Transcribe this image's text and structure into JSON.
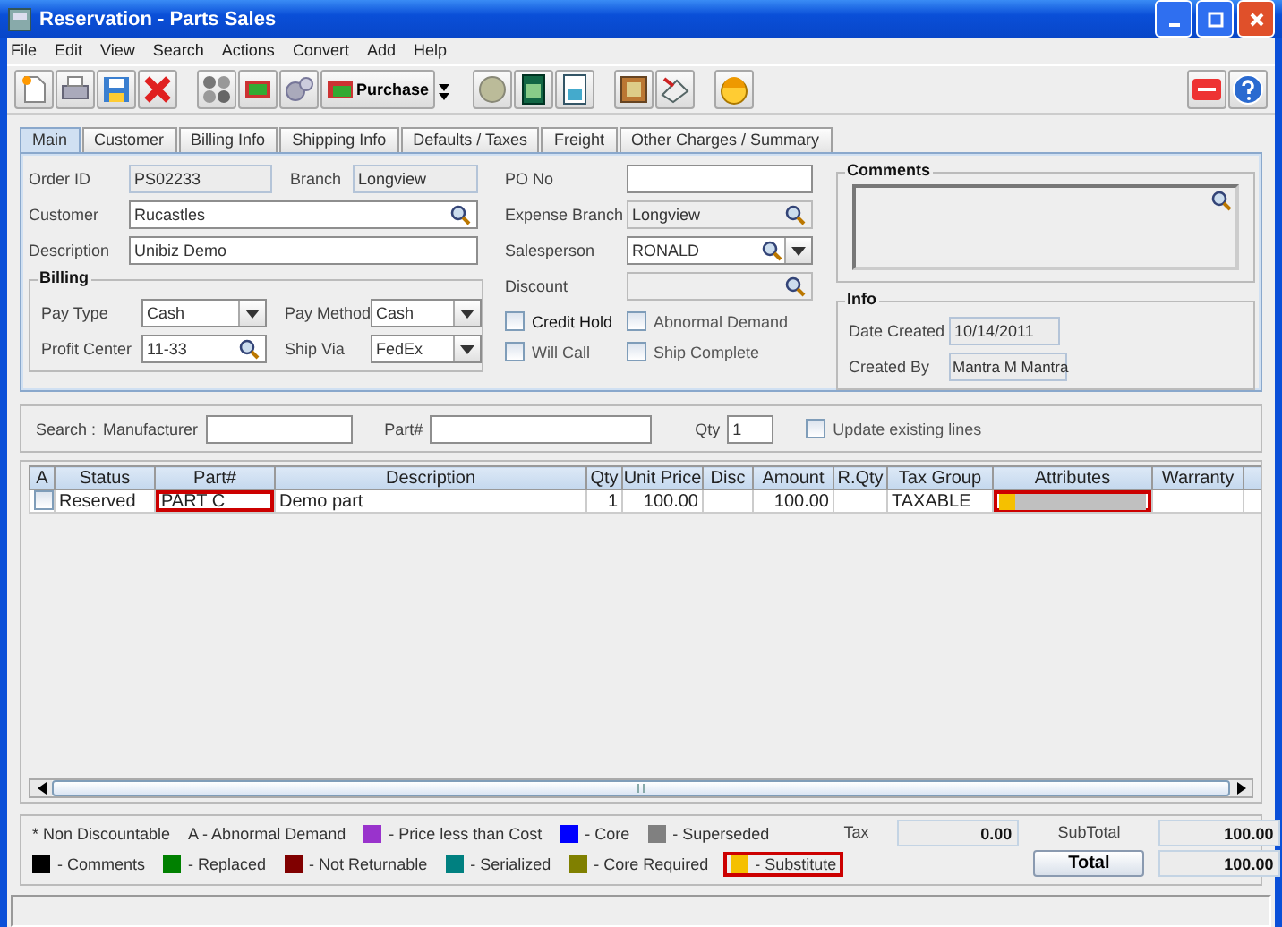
{
  "window": {
    "title": "Reservation - Parts Sales"
  },
  "menu": [
    {
      "label": "File"
    },
    {
      "label": "Edit"
    },
    {
      "label": "View"
    },
    {
      "label": "Search"
    },
    {
      "label": "Actions"
    },
    {
      "label": "Convert"
    },
    {
      "label": "Add"
    },
    {
      "label": "Help"
    }
  ],
  "toolbar": {
    "purchase_label": "Purchase"
  },
  "tabs": [
    {
      "label": "Main",
      "selected": true
    },
    {
      "label": "Customer",
      "selected": false
    },
    {
      "label": "Billing Info",
      "selected": false
    },
    {
      "label": "Shipping Info",
      "selected": false
    },
    {
      "label": "Defaults / Taxes",
      "selected": false
    },
    {
      "label": "Freight",
      "selected": false
    },
    {
      "label": "Other Charges / Summary",
      "selected": false
    }
  ],
  "form": {
    "order_id": {
      "label": "Order ID",
      "value": "PS02233"
    },
    "branch": {
      "label": "Branch",
      "value": "Longview"
    },
    "customer": {
      "label": "Customer",
      "value": "Rucastles"
    },
    "description": {
      "label": "Description",
      "value": "Unibiz Demo"
    },
    "billing": {
      "title": "Billing",
      "pay_type": {
        "label": "Pay Type",
        "value": "Cash"
      },
      "pay_method": {
        "label": "Pay Method",
        "value": "Cash"
      },
      "profit_center": {
        "label": "Profit Center",
        "value": "11-33"
      },
      "ship_via": {
        "label": "Ship Via",
        "value": "FedEx"
      }
    },
    "po_no": {
      "label": "PO No"
    },
    "expense_branch": {
      "label": "Expense Branch",
      "value": "Longview"
    },
    "salesperson": {
      "label": "Salesperson",
      "value": "RONALD"
    },
    "discount": {
      "label": "Discount"
    },
    "checkboxes": [
      {
        "label": "Credit Hold",
        "checked": false
      },
      {
        "label": "Abnormal Demand",
        "checked": false
      },
      {
        "label": "Will Call",
        "checked": false
      },
      {
        "label": "Ship Complete",
        "checked": false
      }
    ],
    "comments": {
      "title": "Comments"
    },
    "info": {
      "title": "Info",
      "date_created": {
        "label": "Date Created",
        "value": "10/14/2011"
      },
      "created_by": {
        "label": "Created By",
        "value": "Mantra M Mantra"
      }
    }
  },
  "search": {
    "label": "Search :",
    "manufacturer_label": "Manufacturer",
    "part_label": "Part#",
    "qty_label": "Qty",
    "qty_value": "1",
    "update_label": "Update existing lines",
    "update_checked": false
  },
  "table": {
    "columns": [
      {
        "label": "A",
        "kind": "text"
      },
      {
        "label": "Status",
        "kind": "text"
      },
      {
        "label": "Part#",
        "kind": "text"
      },
      {
        "label": "Description",
        "kind": "text"
      },
      {
        "label": "Qty",
        "kind": "number"
      },
      {
        "label": "Unit Price",
        "kind": "number"
      },
      {
        "label": "Disc",
        "kind": "number"
      },
      {
        "label": "Amount",
        "kind": "number"
      },
      {
        "label": "R.Qty",
        "kind": "number"
      },
      {
        "label": "Tax Group",
        "kind": "text"
      },
      {
        "label": "Attributes",
        "kind": "text"
      },
      {
        "label": "Warranty",
        "kind": "text"
      }
    ],
    "rows": [
      {
        "cells": [
          {
            "kind": "checkbox",
            "checked": false
          },
          {
            "kind": "text",
            "text": "Reserved",
            "highlighted": false
          },
          {
            "kind": "text",
            "text": "PART C",
            "highlighted": true
          },
          {
            "kind": "text",
            "text": "Demo part",
            "highlighted": false
          },
          {
            "kind": "text",
            "text": "1",
            "highlighted": false
          },
          {
            "kind": "text",
            "text": "100.00",
            "highlighted": false
          },
          {
            "kind": "empty"
          },
          {
            "kind": "text",
            "text": "100.00",
            "highlighted": false
          },
          {
            "kind": "empty"
          },
          {
            "kind": "text",
            "text": "TAXABLE",
            "highlighted": false
          },
          {
            "kind": "attributes",
            "color": "#f5c000",
            "highlighted": true
          },
          {
            "kind": "empty"
          }
        ]
      }
    ]
  },
  "legend": [
    {
      "kind": "text",
      "text": "* Non Discountable"
    },
    {
      "kind": "text",
      "text": "A - Abnormal Demand"
    },
    {
      "kind": "swatch",
      "color": "#9933cc",
      "text": "- Price less than Cost",
      "highlighted": false
    },
    {
      "kind": "swatch",
      "color": "#0000ff",
      "text": "- Core",
      "highlighted": false
    },
    {
      "kind": "swatch",
      "color": "#808080",
      "text": "- Superseded",
      "highlighted": false
    },
    {
      "kind": "break"
    },
    {
      "kind": "swatch",
      "color": "#000000",
      "text": "- Comments",
      "highlighted": false
    },
    {
      "kind": "swatch",
      "color": "#008000",
      "text": "- Replaced",
      "highlighted": false
    },
    {
      "kind": "swatch",
      "color": "#800000",
      "text": "- Not Returnable",
      "highlighted": false
    },
    {
      "kind": "swatch",
      "color": "#008080",
      "text": "- Serialized",
      "highlighted": false
    },
    {
      "kind": "swatch",
      "color": "#808000",
      "text": "- Core Required",
      "highlighted": false
    },
    {
      "kind": "swatch",
      "color": "#f5c000",
      "text": "- Substitute",
      "highlighted": true
    }
  ],
  "totals": {
    "tax_label": "Tax",
    "tax": "0.00",
    "subtotal_label": "SubTotal",
    "subtotal": "100.00",
    "total_button": "Total",
    "total": "100.00"
  }
}
